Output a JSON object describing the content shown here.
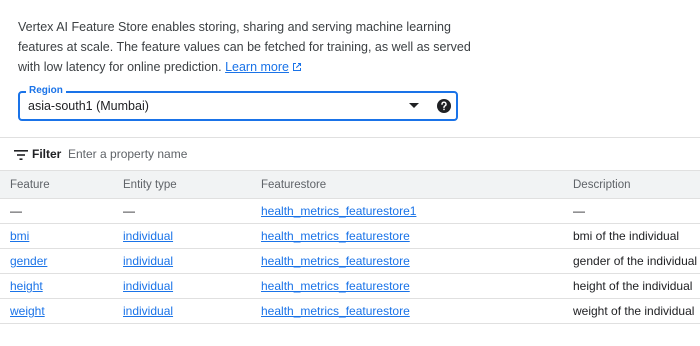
{
  "intro": {
    "text": "Vertex AI Feature Store enables storing, sharing and serving machine learning features at scale. The feature values can be fetched for training, as well as served with low latency for online prediction.",
    "learn_more": "Learn more"
  },
  "region": {
    "label": "Region",
    "value": "asia-south1 (Mumbai)"
  },
  "filter": {
    "label": "Filter",
    "placeholder": "Enter a property name"
  },
  "table": {
    "columns": [
      "Feature",
      "Entity type",
      "Featurestore",
      "Description"
    ],
    "rows": [
      {
        "feature": "—",
        "entity_type": "—",
        "featurestore": "health_metrics_featurestore1",
        "description": "—"
      },
      {
        "feature": "bmi",
        "entity_type": "individual",
        "featurestore": "health_metrics_featurestore",
        "description": "bmi of the individual"
      },
      {
        "feature": "gender",
        "entity_type": "individual",
        "featurestore": "health_metrics_featurestore",
        "description": "gender of the individual"
      },
      {
        "feature": "height",
        "entity_type": "individual",
        "featurestore": "health_metrics_featurestore",
        "description": "height of the individual"
      },
      {
        "feature": "weight",
        "entity_type": "individual",
        "featurestore": "health_metrics_featurestore",
        "description": "weight of the individual"
      }
    ]
  },
  "colors": {
    "accent": "#1a73e8",
    "text": "#202124",
    "muted": "#5f6368",
    "header_bg": "#f1f3f4",
    "divider": "#e0e0e0"
  },
  "icons": {
    "external_link": "external-link-icon",
    "dropdown": "chevron-down-icon",
    "help": "help-icon",
    "filter": "filter-icon"
  }
}
